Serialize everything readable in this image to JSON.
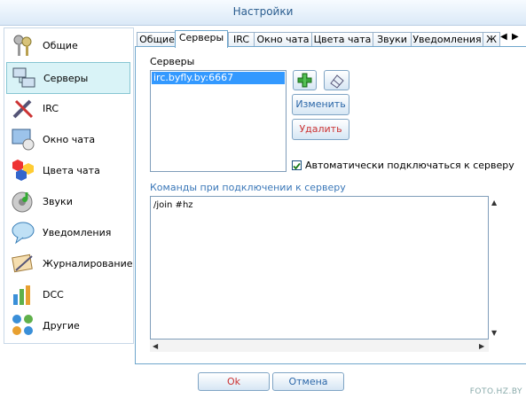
{
  "window": {
    "title": "Настройки"
  },
  "sidebar": {
    "items": [
      {
        "label": "Общие",
        "icon": "keys-icon"
      },
      {
        "label": "Серверы",
        "icon": "network-icon"
      },
      {
        "label": "IRC",
        "icon": "tools-icon"
      },
      {
        "label": "Окно чата",
        "icon": "chat-window-icon"
      },
      {
        "label": "Цвета чата",
        "icon": "colors-icon"
      },
      {
        "label": "Звуки",
        "icon": "sound-icon"
      },
      {
        "label": "Уведомления",
        "icon": "notification-icon"
      },
      {
        "label": "Журналирование",
        "icon": "logging-icon"
      },
      {
        "label": "DCC",
        "icon": "dcc-icon"
      },
      {
        "label": "Другие",
        "icon": "other-icon"
      }
    ],
    "active": "Серверы"
  },
  "tabs": {
    "items": [
      "Общие",
      "Серверы",
      "IRC",
      "Окно чата",
      "Цвета чата",
      "Звуки",
      "Уведомления",
      "Ж"
    ],
    "active": "Серверы"
  },
  "servers": {
    "label": "Серверы",
    "list": [
      "irc.byfly.by:6667"
    ],
    "edit_label": "Изменить",
    "delete_label": "Удалить",
    "autoconnect_label": "Автоматически подключаться к серверу",
    "autoconnect_checked": true
  },
  "commands": {
    "label": "Команды при подключении к серверу",
    "text": "/join #hz"
  },
  "footer": {
    "ok_label": "Ok",
    "cancel_label": "Отмена"
  },
  "watermark": "FOTO.HZ.BY",
  "colors": {
    "accent": "#3399ff",
    "border": "#6fa6cc",
    "title": "#2a5d8f"
  }
}
